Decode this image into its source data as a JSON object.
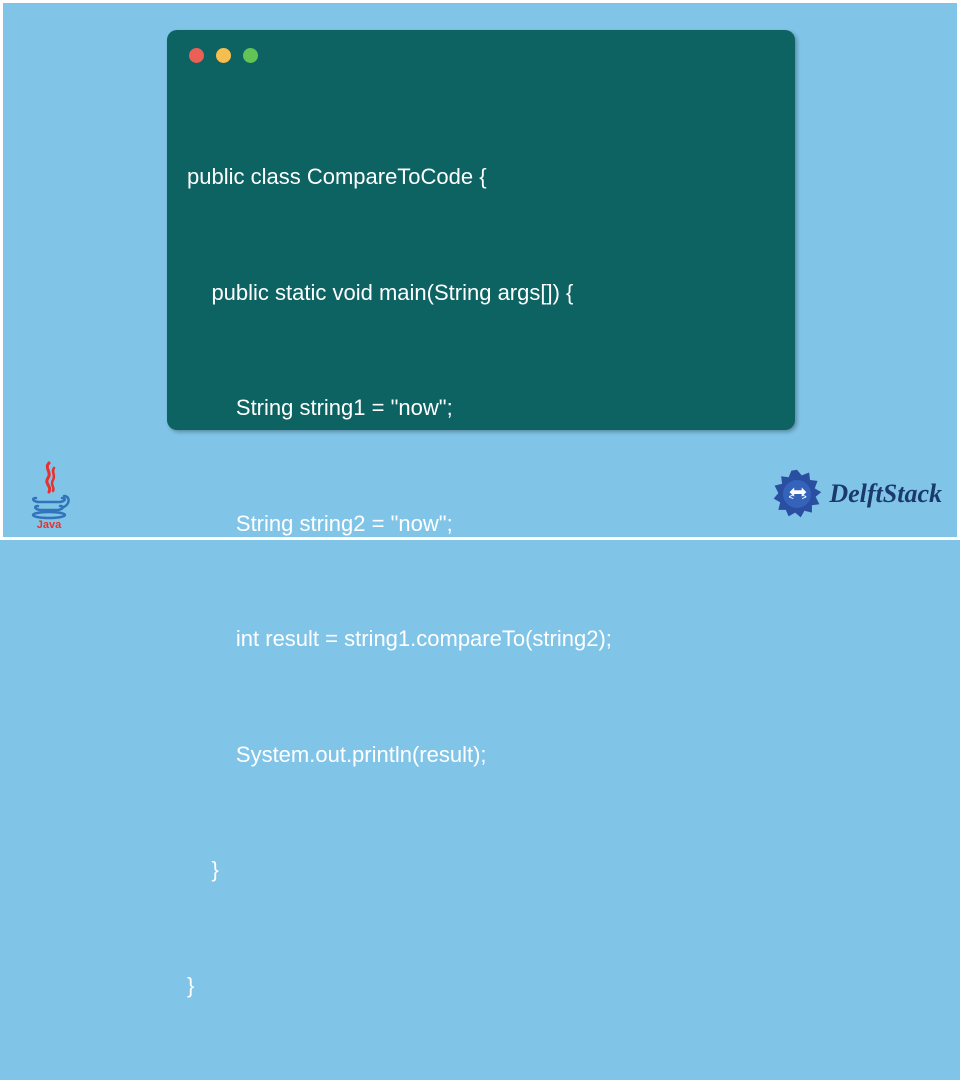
{
  "code": {
    "lines": [
      "public class CompareToCode {",
      "    public static void main(String args[]) {",
      "        String string1 = \"now\";",
      "        String string2 = \"now\";",
      "        int result = string1.compareTo(string2);",
      "        System.out.println(result);",
      "    }",
      "}"
    ]
  },
  "logos": {
    "java_label": "Java",
    "delft_label": "DelftStack"
  },
  "traffic_lights": {
    "red": "#ec5f54",
    "yellow": "#f5be4f",
    "green": "#61c454"
  }
}
